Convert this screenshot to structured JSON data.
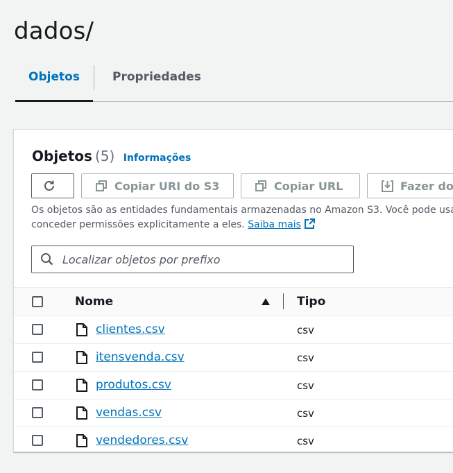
{
  "page": {
    "title": "dados/"
  },
  "tabs": [
    {
      "label": "Objetos",
      "active": true
    },
    {
      "label": "Propriedades",
      "active": false
    }
  ],
  "panel": {
    "title": "Objetos",
    "count": "(5)",
    "info_link": "Informações",
    "buttons": {
      "refresh_icon": "refresh-icon",
      "copy_uri": "Copiar URI do S3",
      "copy_url": "Copiar URL",
      "download": "Fazer do"
    },
    "description_line1": "Os objetos são as entidades fundamentais armazenadas no Amazon S3. Você pode usar o",
    "description_line2": "conceder permissões explicitamente a eles.",
    "learn_more": "Saiba mais",
    "search_placeholder": "Localizar objetos por prefixo"
  },
  "table": {
    "columns": {
      "name": "Nome",
      "type": "Tipo"
    },
    "rows": [
      {
        "name": "clientes.csv",
        "type": "csv"
      },
      {
        "name": "itensvenda.csv",
        "type": "csv"
      },
      {
        "name": "produtos.csv",
        "type": "csv"
      },
      {
        "name": "vendas.csv",
        "type": "csv"
      },
      {
        "name": "vendedores.csv",
        "type": "csv"
      }
    ]
  },
  "colors": {
    "accent": "#0073bb",
    "text": "#16191f",
    "muted": "#545b64",
    "background": "#f2f3f3"
  }
}
